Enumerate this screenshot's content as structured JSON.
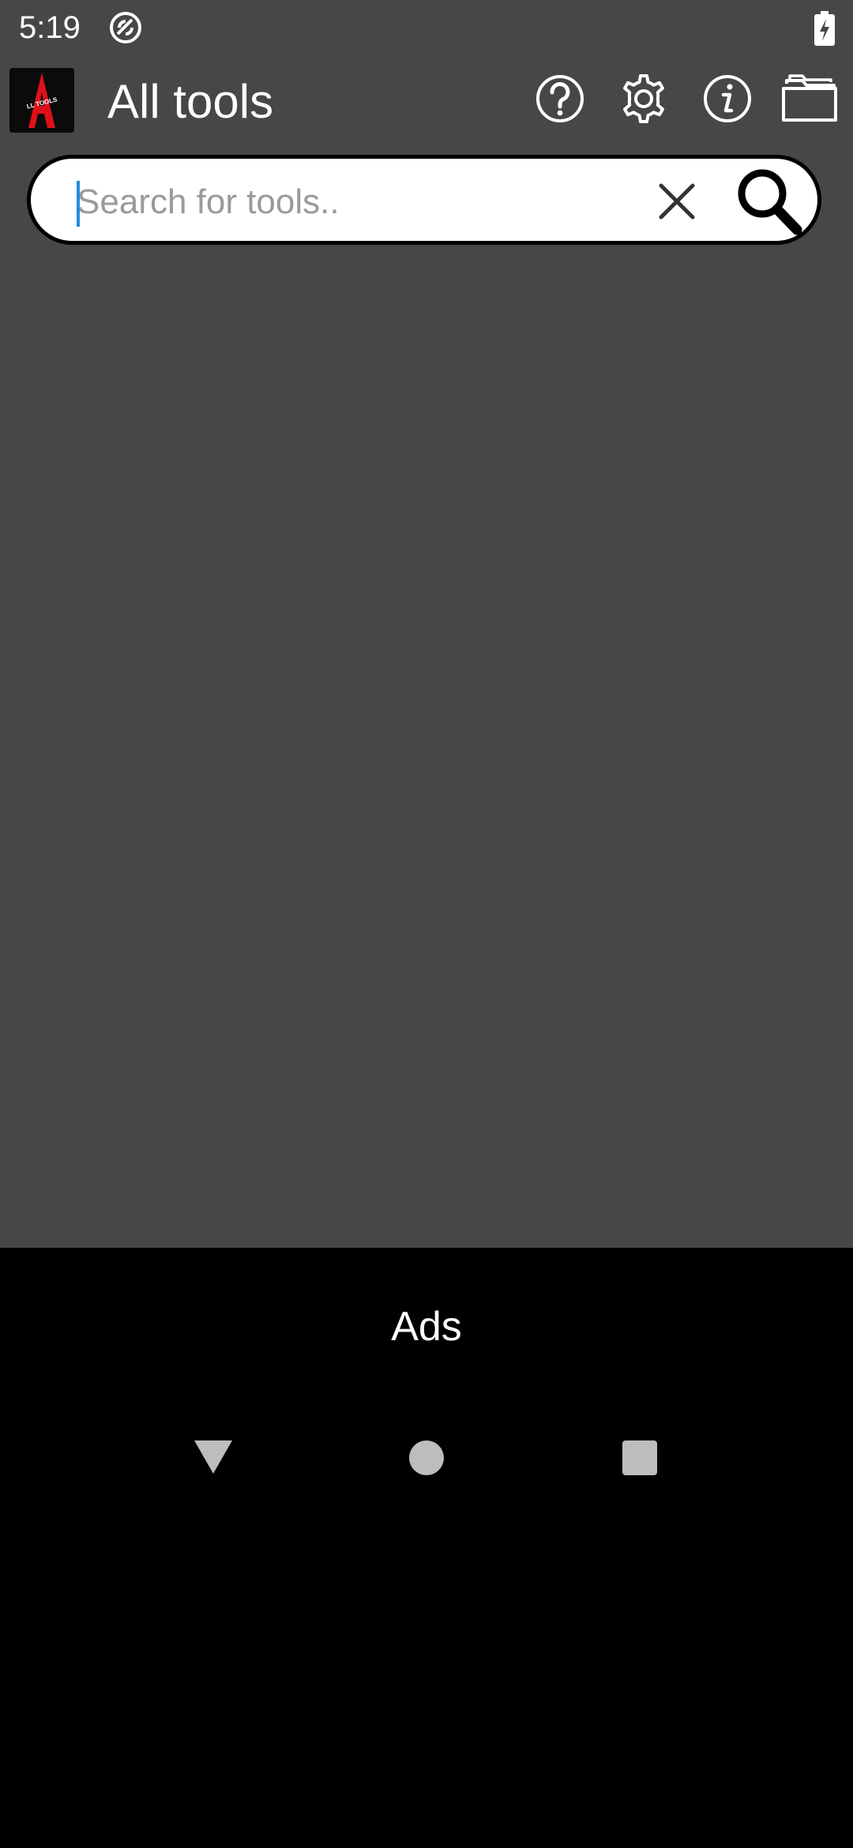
{
  "status_bar": {
    "time": "5:19",
    "icons": [
      "sync-icon",
      "battery-charging-icon"
    ]
  },
  "toolbar": {
    "title": "All tools",
    "logo_icon": "app-logo-a",
    "logo_text": "LL TOOLS",
    "actions": [
      {
        "name": "help-icon"
      },
      {
        "name": "settings-icon"
      },
      {
        "name": "info-icon"
      },
      {
        "name": "folder-icon"
      }
    ]
  },
  "search": {
    "placeholder": "Search for tools..",
    "value": "",
    "clear_icon": "close-icon",
    "search_icon": "search-icon"
  },
  "ads": {
    "label": "Ads"
  },
  "nav": {
    "buttons": [
      "back-icon",
      "home-icon",
      "recents-icon"
    ]
  },
  "colors": {
    "app_background": "#474747",
    "bottom_background": "#000000",
    "caret": "#1e90d8",
    "logo_red": "#e0101a"
  }
}
